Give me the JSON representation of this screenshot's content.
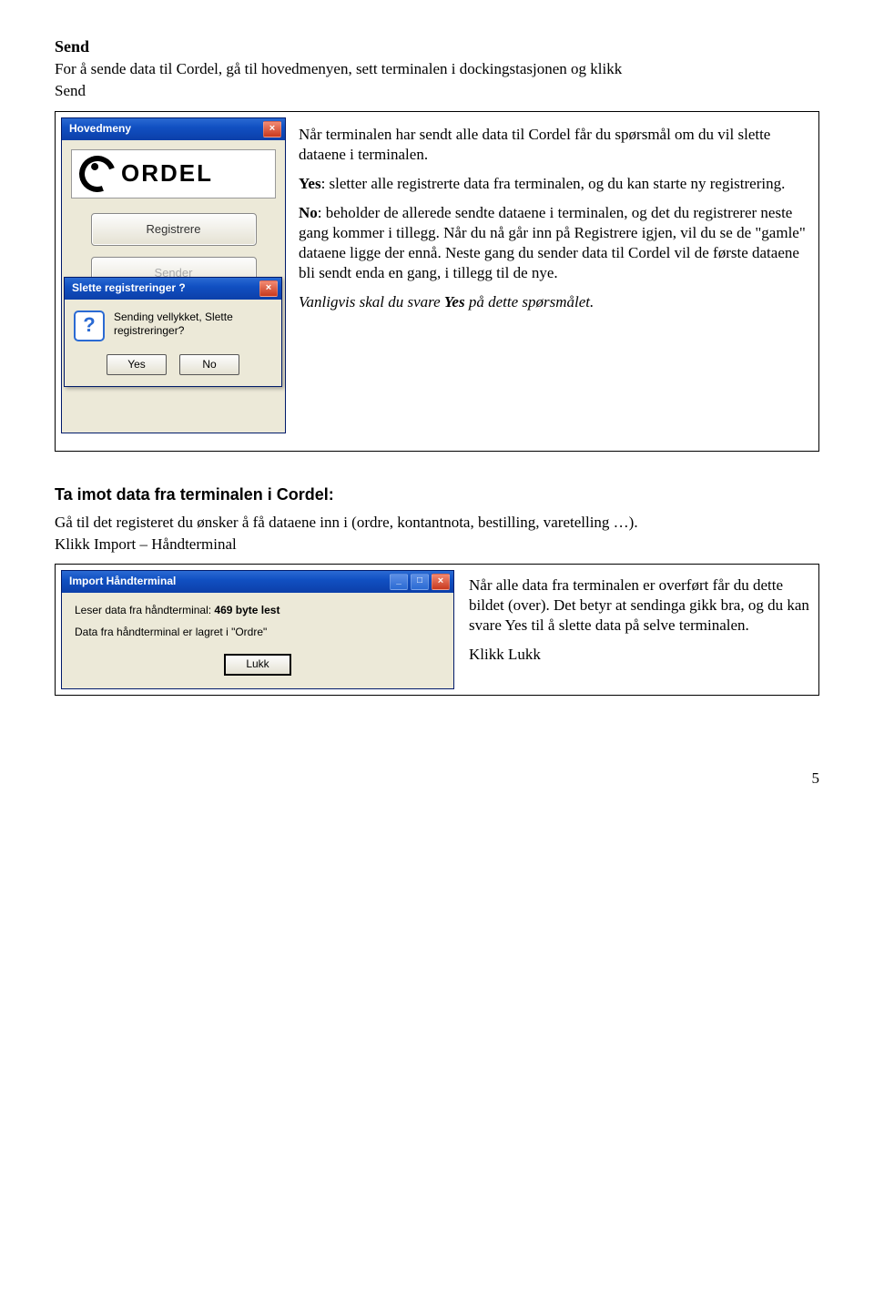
{
  "send_section": {
    "title": "Send",
    "intro_line1": "For å sende data til Cordel, gå til hovedmenyen, sett terminalen i dockingstasjonen og klikk",
    "intro_line2": "Send",
    "para1": "Når terminalen har sendt alle data til Cordel får du spørsmål om du vil slette dataene i terminalen.",
    "yes_prefix": "Yes",
    "yes_rest": ": sletter alle registrerte data fra terminalen, og du kan starte ny registrering.",
    "no_prefix": "No",
    "no_rest": ": beholder de allerede sendte dataene i terminalen, og det du registrerer neste gang kommer i tillegg. Når du nå går inn på Registrere igjen, vil du se de \"gamle\" dataene ligge der ennå. Neste gang du sender data til Cordel vil de første dataene bli sendt enda en gang, i tillegg til de nye.",
    "usual_prefix": "Vanligvis skal du svare ",
    "usual_yes": "Yes",
    "usual_suffix": " på dette spørsmålet."
  },
  "hovedmeny_window": {
    "title": "Hovedmeny",
    "close": "×",
    "logo_text": "ORDEL",
    "btn_registrere": "Registrere",
    "btn_sender": "Sender"
  },
  "delete_dialog": {
    "title": "Slette registreringer ?",
    "close": "×",
    "question_icon": "?",
    "msg_line1": "Sending vellykket, Slette",
    "msg_line2": "registreringer?",
    "yes": "Yes",
    "no": "No"
  },
  "import_section": {
    "title": "Ta imot data fra terminalen i Cordel:",
    "intro1": "Gå til det registeret du ønsker å få dataene inn i (ordre, kontantnota, bestilling, varetelling …).",
    "intro2": "Klikk Import – Håndterminal",
    "dialog": {
      "title": "Import Håndterminal",
      "close": "×",
      "min": "_",
      "max": "□",
      "line1_prefix": "Leser data fra håndterminal:   ",
      "line1_bold": "469  byte lest",
      "line2": "Data fra håndterminal er lagret i \"Ordre\"",
      "lukk": "Lukk"
    },
    "side_para1": "Når alle data fra terminalen er overført får du dette bildet (over). Det betyr at sendinga gikk bra, og du kan svare Yes til å slette data på selve terminalen.",
    "side_para2": "Klikk Lukk"
  },
  "page_number": "5"
}
